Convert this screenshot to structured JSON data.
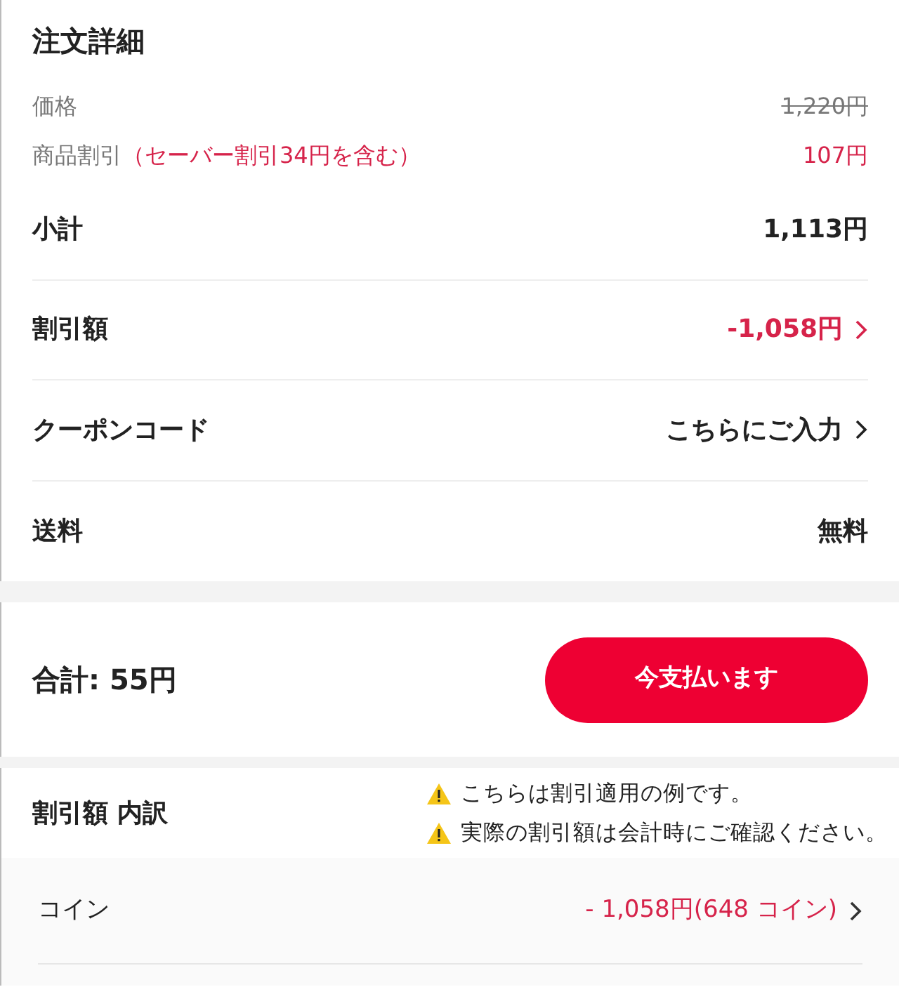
{
  "order_details": {
    "title": "注文詳細",
    "price_lines": [
      {
        "kind": "strike",
        "label": "価格",
        "value": "1,220円"
      },
      {
        "kind": "discount",
        "label": "商品割引",
        "note": "（セーバー割引34円を含む）",
        "value": "107円"
      }
    ],
    "rows": [
      {
        "kind": "plain",
        "label": "小計",
        "value": "1,113円"
      },
      {
        "kind": "discount",
        "label": "割引額",
        "value": "-1,058円"
      },
      {
        "kind": "link",
        "label": "クーポンコード",
        "value": "こちらにご入力"
      },
      {
        "kind": "plain",
        "label": "送料",
        "value": "無料"
      }
    ]
  },
  "checkout": {
    "total": "合計: 55円",
    "pay_button": "今支払います"
  },
  "breakdown": {
    "title": "割引額 内訳",
    "notices": [
      "こちらは割引適用の例です。",
      "実際の割引額は会計時にご確認ください。"
    ],
    "items": [
      {
        "label": "コイン",
        "value": "- 1,058円(648 コイン)"
      }
    ]
  }
}
